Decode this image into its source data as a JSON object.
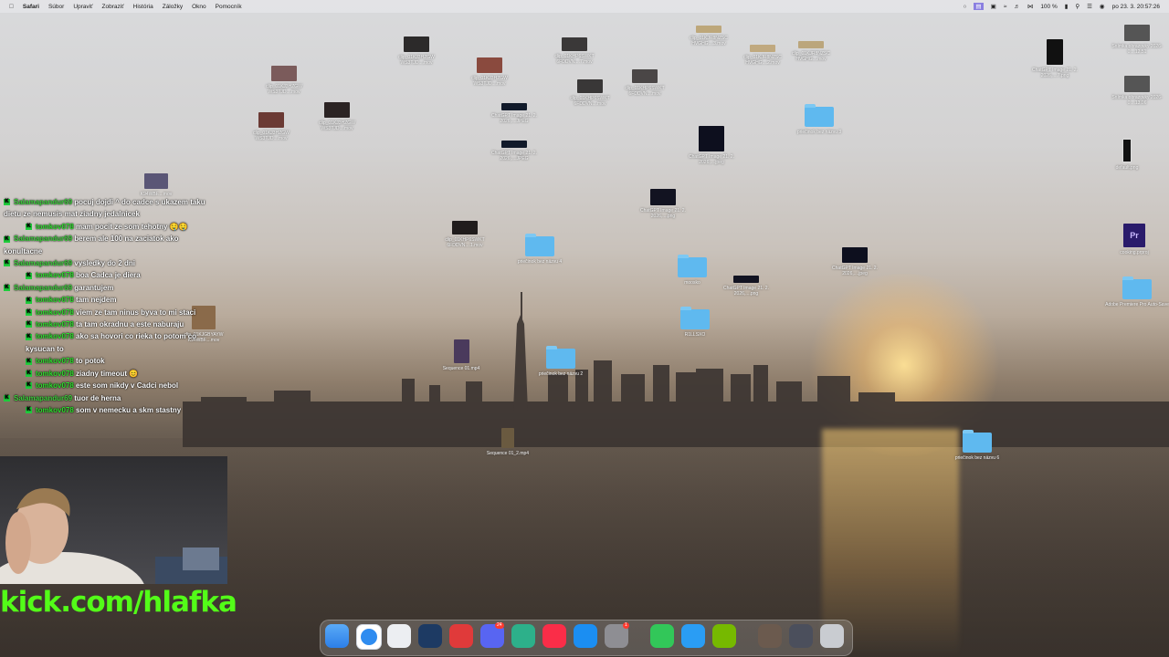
{
  "menubar": {
    "apple": "",
    "app": "Safari",
    "items": [
      "Súbor",
      "Upraviť",
      "Zobraziť",
      "História",
      "Záložky",
      "Okno",
      "Pomocník"
    ],
    "battery": "100 %",
    "clock": "po 23. 3.  20:57:26"
  },
  "desktop": {
    "icons": [
      {
        "label": "clip_01KJ3HZGW WS3TJD....mov",
        "kind": "clip"
      },
      {
        "label": "clip_01KJ3HZGW WS3TJD....mov",
        "kind": "clip"
      },
      {
        "label": "clip_01KJ3HZGW WS3TJD....mov",
        "kind": "clip"
      },
      {
        "label": "clip_01KHP6SWKT 6FDDVN....7.mov",
        "kind": "clip"
      },
      {
        "label": "clip_01KHP6SWKT 6FDDVN....mov",
        "kind": "clip"
      },
      {
        "label": "clip_01KHP6SWKT 6FDDVN....mov",
        "kind": "clip"
      },
      {
        "label": "clip_01KJR8NZSC HVGHG....3.mov",
        "kind": "clip"
      },
      {
        "label": "clip_01KJR8NZSC HVGHG....2.mov",
        "kind": "clip"
      },
      {
        "label": "clip_01KJR8NZSC HVGHG....mov",
        "kind": "clip"
      },
      {
        "label": "clip_01KJ3HZGW WS3TJD....mov",
        "kind": "clip"
      },
      {
        "label": "clip_01KJ3HZGW WS3TJD....mov",
        "kind": "clip"
      },
      {
        "label": "ChatGPT Image 21. 2. 2026,....JPEG",
        "kind": "img"
      },
      {
        "label": "ChatGPT Image 21. 2. 2026,....JPEG",
        "kind": "img"
      },
      {
        "label": "ChatGPT Image 21. 2. 2026,....jpeg",
        "kind": "img"
      },
      {
        "label": "ChatGPT Image 21. 2. 2026,....png",
        "kind": "img"
      },
      {
        "label": "ChatGPT Image 21. 2. 2026,....png",
        "kind": "img"
      },
      {
        "label": "ChatGPT Image 21. 2. 2026,....jpeg",
        "kind": "img"
      },
      {
        "label": "ChatGPT Image 21. 2. 2026,....jpeg",
        "kind": "img"
      },
      {
        "label": "priečinok bez názvu 3",
        "kind": "folder"
      },
      {
        "label": "priečinok bez názvu 4",
        "kind": "folder"
      },
      {
        "label": "moosko",
        "kind": "folder"
      },
      {
        "label": "R1LLSXO",
        "kind": "folder"
      },
      {
        "label": "priečinok bez názvu 2",
        "kind": "folder"
      },
      {
        "label": "priečinok bez názvu 6",
        "kind": "folder"
      },
      {
        "label": "clip_01KHP6SWKT 6FDDVN....1.mov",
        "kind": "clip"
      },
      {
        "label": "Sequence 01.mp4",
        "kind": "clip"
      },
      {
        "label": "Sequence 01_2.mp4",
        "kind": "clip"
      },
      {
        "label": "Snímka obrazovky 2026-0....12.51",
        "kind": "img"
      },
      {
        "label": "Snímka obrazovky 2026-0....13.06",
        "kind": "img"
      },
      {
        "label": "ChatGPT Image 21. 2. 2026,....7.png",
        "kind": "img"
      },
      {
        "label": "default.png",
        "kind": "img"
      },
      {
        "label": "cooking.prproj",
        "kind": "premiere"
      },
      {
        "label": "Adobe Premiere Pro Auto-Save",
        "kind": "folder"
      },
      {
        "label": "clip_01KJR8NZSC HVGHG....4.mov",
        "kind": "clip"
      },
      {
        "label": "clip_01KJGBYAYW K94WBF....mov",
        "kind": "clip"
      },
      {
        "label": "K94WBF....mov",
        "kind": "clip"
      }
    ]
  },
  "chat": {
    "lines": [
      {
        "user": "Salamapandur69",
        "text": "pocuj dojdi ^ do cadce s ukazem taku dietu ze nemusis mat ziadny jedalnicek",
        "indent": false
      },
      {
        "user": "tomkov078",
        "text": "mam pocit ze som tehotny 🤤🤤",
        "indent": true
      },
      {
        "user": "Salamapandur69",
        "text": "berem ale 100 na zaciatok ako konultacne",
        "indent": false
      },
      {
        "user": "Salamapandur69",
        "text": "vysledky do 2 dni",
        "indent": false
      },
      {
        "user": "tomkov078",
        "text": "boa Cadca je diera",
        "indent": true
      },
      {
        "user": "Salamapandur69",
        "text": "garantujem",
        "indent": false
      },
      {
        "user": "tomkov078",
        "text": "tam nejdem",
        "indent": true
      },
      {
        "user": "tomkov078",
        "text": "viem ze tam ninus byva to mi staci",
        "indent": true
      },
      {
        "user": "tomkov078",
        "text": "ta tam okradnu a este naburaju",
        "indent": true
      },
      {
        "user": "tomkov078",
        "text": "ako sa hovori co rieka to potom co kysucan to",
        "indent": true
      },
      {
        "user": "tomkov078",
        "text": "to potok",
        "indent": true
      },
      {
        "user": "tomkov078",
        "text": "ziadny timeout 😊",
        "indent": true
      },
      {
        "user": "tomkov078",
        "text": "este som nikdy v Cadci nebol",
        "indent": true
      },
      {
        "user": "Salamapandur69",
        "text": "tuor de herna",
        "indent": false
      },
      {
        "user": "tomkov078",
        "text": "som v nemecku a skm stastny",
        "indent": true
      }
    ],
    "badge": "K"
  },
  "stream": {
    "url": "kick.com/hlafka"
  },
  "dock": {
    "apps": [
      {
        "name": "finder-icon",
        "color": "#3c8ff5"
      },
      {
        "name": "safari-icon",
        "color": "#2f8cf0"
      },
      {
        "name": "launchpad-icon",
        "color": "#e9e9ee"
      },
      {
        "name": "steam-icon",
        "color": "#1d3a63"
      },
      {
        "name": "quicktime-icon",
        "color": "#e03a3a"
      },
      {
        "name": "discord-icon",
        "color": "#5865f2",
        "badge": "24"
      },
      {
        "name": "gamecontroller-icon",
        "color": "#2db08a"
      },
      {
        "name": "music-icon",
        "color": "#fa2d48"
      },
      {
        "name": "appstore-icon",
        "color": "#1b8ef2"
      },
      {
        "name": "settings-icon",
        "color": "#8e8e93",
        "badge": "1"
      },
      {
        "name": "phone-icon",
        "color": "#32c759"
      },
      {
        "name": "quicktime2-icon",
        "color": "#2a9df4"
      },
      {
        "name": "nvidia-icon",
        "color": "#76b900"
      },
      {
        "name": "photo-stack-icon",
        "color": "#6b5a4e"
      },
      {
        "name": "downloads-icon",
        "color": "#4b4f5c"
      },
      {
        "name": "trash-icon",
        "color": "#c9ccd1"
      }
    ]
  }
}
